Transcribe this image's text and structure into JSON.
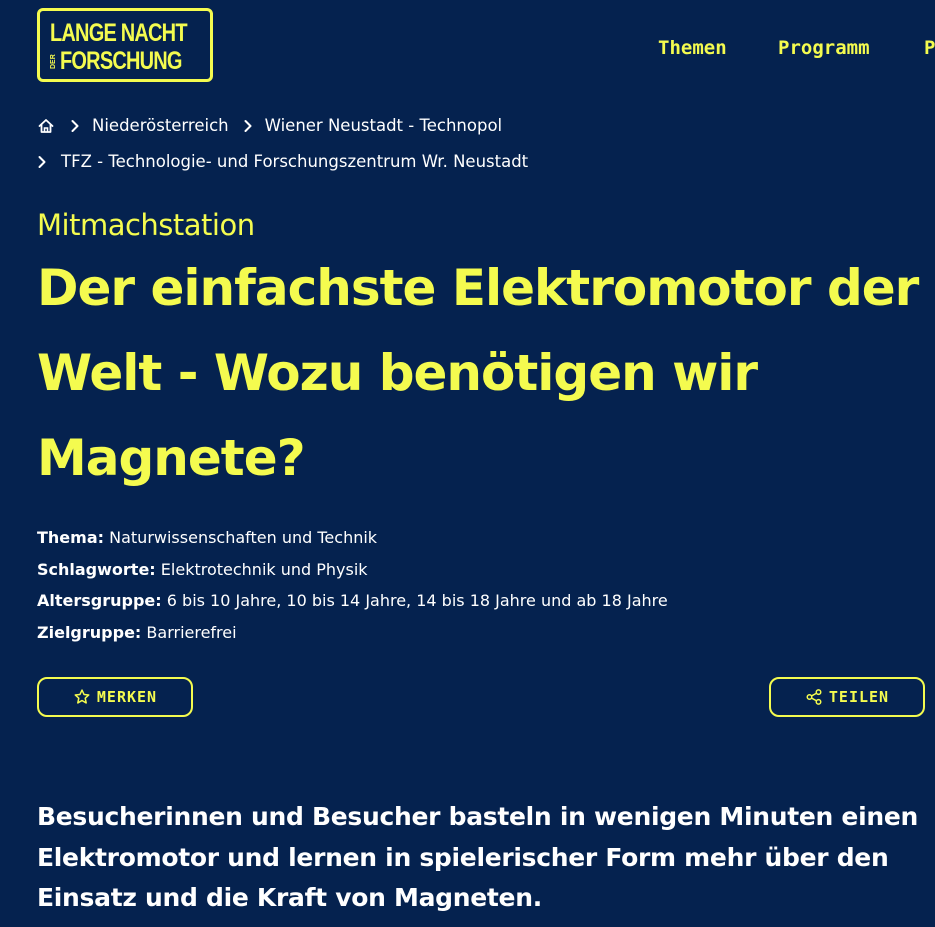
{
  "header": {
    "logo": {
      "line1": "LANGE NACHT",
      "der": "DER",
      "line2": "FORSCHUNG"
    },
    "nav": [
      {
        "label": "Themen"
      },
      {
        "label": "Programm"
      },
      {
        "label": "P"
      }
    ]
  },
  "breadcrumb": {
    "home_icon": "home-icon",
    "items": [
      {
        "label": "Niederösterreich"
      },
      {
        "label": "Wiener Neustadt - Technopol"
      },
      {
        "label": "TFZ - Technologie- und Forschungszentrum Wr. Neustadt"
      }
    ]
  },
  "station": {
    "category": "Mitmachstation",
    "title_lines": [
      "Der einfachste Elektromotor der",
      "Welt - Wozu benötigen wir",
      "Magnete?"
    ],
    "meta": [
      {
        "key": "Thema:",
        "value": "Naturwissenschaften und Technik"
      },
      {
        "key": "Schlagworte:",
        "value": "Elektrotechnik und Physik"
      },
      {
        "key": "Altersgruppe:",
        "value": "6 bis 10 Jahre, 10 bis 14 Jahre, 14 bis 18 Jahre und ab 18 Jahre"
      },
      {
        "key": "Zielgruppe:",
        "value": "Barrierefrei"
      }
    ]
  },
  "actions": {
    "bookmark_label": "MERKEN",
    "bookmark_icon": "star-icon",
    "share_label": "TEILEN",
    "share_icon": "share-icon"
  },
  "intro": {
    "lines": [
      "Besucherinnen und Besucher basteln in wenigen Minuten einen",
      "Elektromotor und lernen in spielerischer Form mehr über den",
      "Einsatz und die Kraft von Magneten."
    ]
  },
  "colors": {
    "background": "#05224f",
    "accent": "#f4fb4f",
    "text": "#ffffff"
  }
}
